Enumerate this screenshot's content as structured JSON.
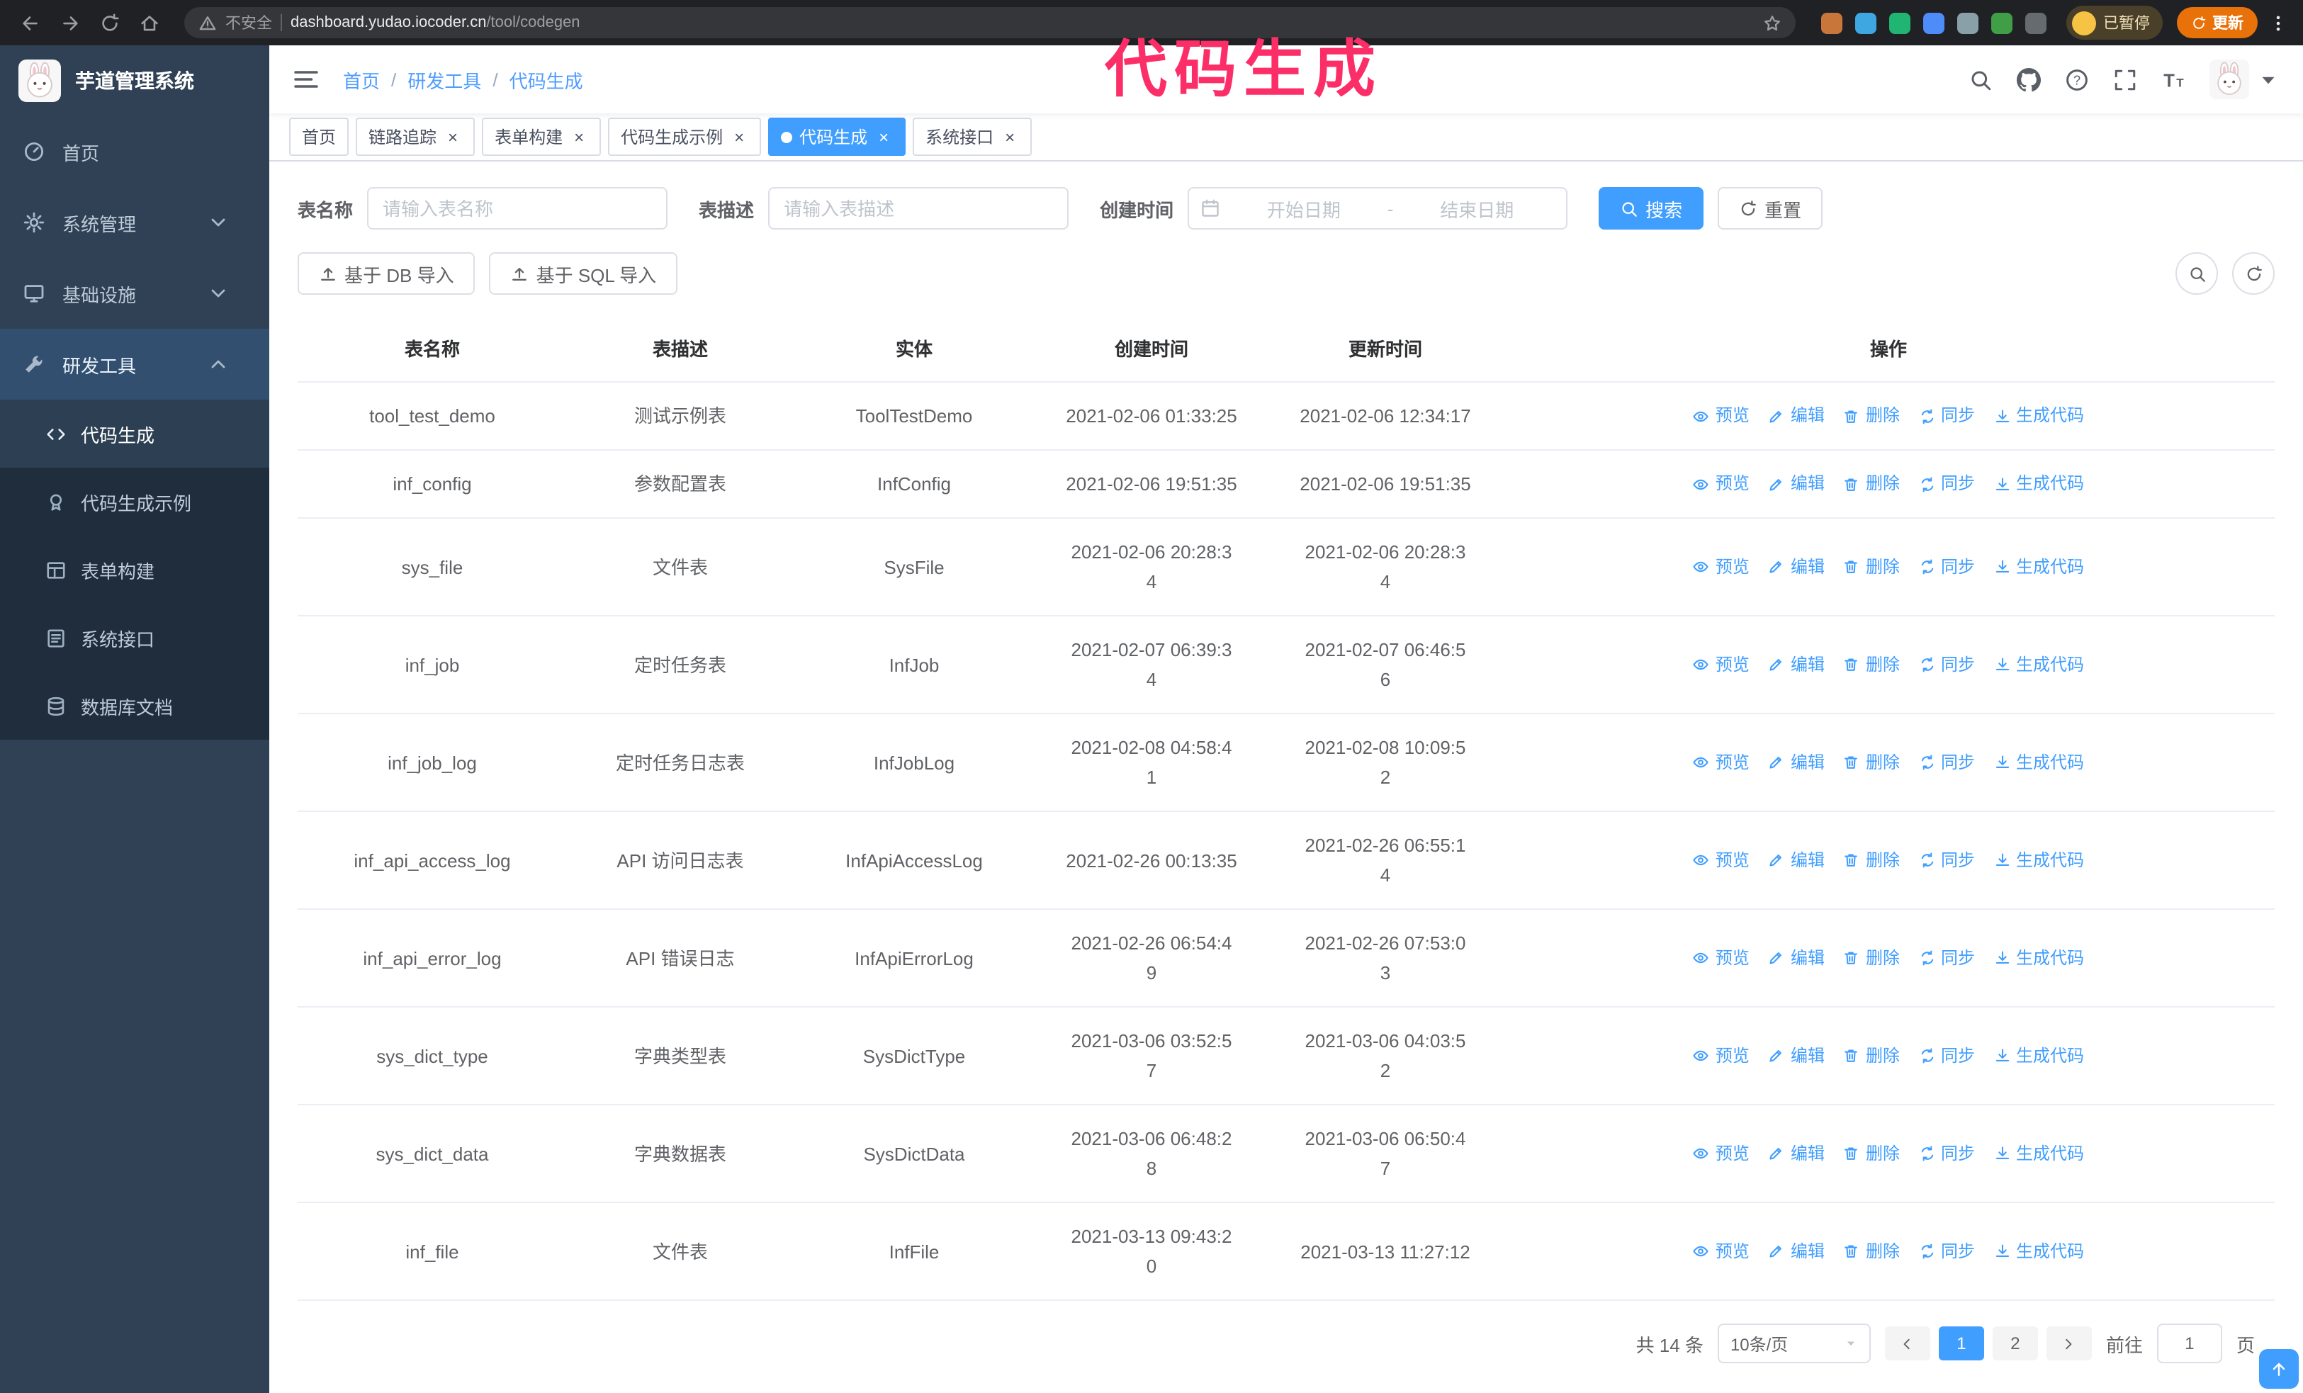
{
  "colors": {
    "accent": "#409eff",
    "sidebar_bg": "#304156",
    "submenu_bg": "#1f2d3d",
    "chrome_bg": "#202124",
    "annotation": "#fb2e68",
    "update_button_bg": "#e8710a"
  },
  "browser": {
    "security_label": "不安全",
    "url_domain": "dashboard.yudao.iocoder.cn",
    "url_path": "/tool/codegen",
    "profile_chip_label": "已暂停",
    "update_button_label": "更新",
    "extensions": [
      {
        "color": "#c9763b"
      },
      {
        "color": "#3ea6e0"
      },
      {
        "color": "#21b573"
      },
      {
        "color": "#4e8cf7"
      },
      {
        "color": "#8aa0a8"
      },
      {
        "color": "#3f9e46"
      },
      {
        "color": "#666b70"
      }
    ]
  },
  "annotation": {
    "text": "代码生成",
    "color": "#fb2e68"
  },
  "sidebar": {
    "logo_title": "芋道管理系统",
    "items": [
      {
        "label": "首页",
        "icon": "gauge",
        "type": "item",
        "expanded": false
      },
      {
        "label": "系统管理",
        "icon": "gear",
        "type": "group",
        "expanded": false
      },
      {
        "label": "基础设施",
        "icon": "monitor",
        "type": "group",
        "expanded": false
      },
      {
        "label": "研发工具",
        "icon": "wrench",
        "type": "group",
        "expanded": true,
        "children": [
          {
            "label": "代码生成",
            "icon": "code",
            "active": true
          },
          {
            "label": "代码生成示例",
            "icon": "badge",
            "active": false
          },
          {
            "label": "表单构建",
            "icon": "grid",
            "active": false
          },
          {
            "label": "系统接口",
            "icon": "list",
            "active": false
          },
          {
            "label": "数据库文档",
            "icon": "database",
            "active": false
          }
        ]
      }
    ]
  },
  "breadcrumb": [
    "首页",
    "研发工具",
    "代码生成"
  ],
  "tabs": [
    {
      "label": "首页",
      "closable": false,
      "active": false
    },
    {
      "label": "链路追踪",
      "closable": true,
      "active": false
    },
    {
      "label": "表单构建",
      "closable": true,
      "active": false
    },
    {
      "label": "代码生成示例",
      "closable": true,
      "active": false
    },
    {
      "label": "代码生成",
      "closable": true,
      "active": true
    },
    {
      "label": "系统接口",
      "closable": true,
      "active": false
    }
  ],
  "filters": {
    "table_name_label": "表名称",
    "table_name_placeholder": "请输入表名称",
    "table_desc_label": "表描述",
    "table_desc_placeholder": "请输入表描述",
    "create_time_label": "创建时间",
    "date_start_placeholder": "开始日期",
    "date_separator": "-",
    "date_end_placeholder": "结束日期",
    "search_button_label": "搜索",
    "reset_button_label": "重置"
  },
  "toolbar": {
    "import_db_label": "基于 DB 导入",
    "import_sql_label": "基于 SQL 导入"
  },
  "table": {
    "columns": [
      "表名称",
      "表描述",
      "实体",
      "创建时间",
      "更新时间",
      "操作"
    ],
    "ops": [
      "预览",
      "编辑",
      "删除",
      "同步",
      "生成代码"
    ],
    "rows": [
      {
        "name": "tool_test_demo",
        "desc": "测试示例表",
        "entity": "ToolTestDemo",
        "created": "2021-02-06 01:33:25",
        "updated": "2021-02-06 12:34:17"
      },
      {
        "name": "inf_config",
        "desc": "参数配置表",
        "entity": "InfConfig",
        "created": "2021-02-06 19:51:35",
        "updated": "2021-02-06 19:51:35"
      },
      {
        "name": "sys_file",
        "desc": "文件表",
        "entity": "SysFile",
        "created": "2021-02-06 20:28:3\n4",
        "updated": "2021-02-06 20:28:3\n4"
      },
      {
        "name": "inf_job",
        "desc": "定时任务表",
        "entity": "InfJob",
        "created": "2021-02-07 06:39:3\n4",
        "updated": "2021-02-07 06:46:5\n6"
      },
      {
        "name": "inf_job_log",
        "desc": "定时任务日志表",
        "entity": "InfJobLog",
        "created": "2021-02-08 04:58:4\n1",
        "updated": "2021-02-08 10:09:5\n2"
      },
      {
        "name": "inf_api_access_log",
        "desc": "API 访问日志表",
        "entity": "InfApiAccessLog",
        "created": "2021-02-26 00:13:35",
        "updated": "2021-02-26 06:55:1\n4"
      },
      {
        "name": "inf_api_error_log",
        "desc": "API 错误日志",
        "entity": "InfApiErrorLog",
        "created": "2021-02-26 06:54:4\n9",
        "updated": "2021-02-26 07:53:0\n3"
      },
      {
        "name": "sys_dict_type",
        "desc": "字典类型表",
        "entity": "SysDictType",
        "created": "2021-03-06 03:52:5\n7",
        "updated": "2021-03-06 04:03:5\n2"
      },
      {
        "name": "sys_dict_data",
        "desc": "字典数据表",
        "entity": "SysDictData",
        "created": "2021-03-06 06:48:2\n8",
        "updated": "2021-03-06 06:50:4\n7"
      },
      {
        "name": "inf_file",
        "desc": "文件表",
        "entity": "InfFile",
        "created": "2021-03-13 09:43:2\n0",
        "updated": "2021-03-13 11:27:12"
      }
    ]
  },
  "pagination": {
    "total_text": "共 14 条",
    "page_size": "10条/页",
    "pages": [
      "1",
      "2"
    ],
    "active_page": "1",
    "goto_label": "前往",
    "goto_value": "1",
    "goto_suffix": "页"
  }
}
